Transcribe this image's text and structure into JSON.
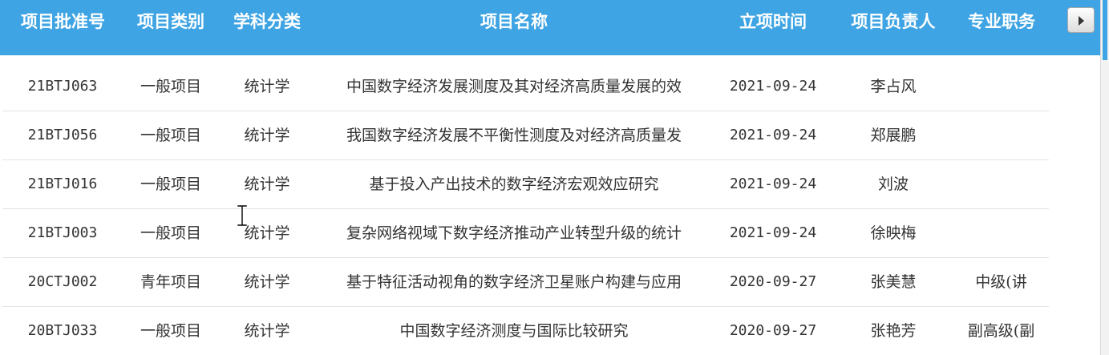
{
  "table": {
    "headers": [
      "项目批准号",
      "项目类别",
      "学科分类",
      "项目名称",
      "立项时间",
      "项目负责人",
      "专业职务"
    ],
    "rows": [
      [
        "21BTJ063",
        "一般项目",
        "统计学",
        "中国数字经济发展测度及其对经济高质量发展的效",
        "2021-09-24",
        "李占风",
        ""
      ],
      [
        "21BTJ056",
        "一般项目",
        "统计学",
        "我国数字经济发展不平衡性测度及对经济高质量发",
        "2021-09-24",
        "郑展鹏",
        ""
      ],
      [
        "21BTJ016",
        "一般项目",
        "统计学",
        "基于投入产出技术的数字经济宏观效应研究",
        "2021-09-24",
        "刘波",
        ""
      ],
      [
        "21BTJ003",
        "一般项目",
        "统计学",
        "复杂网络视域下数字经济推动产业转型升级的统计",
        "2021-09-24",
        "徐映梅",
        ""
      ],
      [
        "20CTJ002",
        "青年项目",
        "统计学",
        "基于特征活动视角的数字经济卫星账户构建与应用",
        "2020-09-27",
        "张美慧",
        "中级(讲"
      ],
      [
        "20BTJ033",
        "一般项目",
        "统计学",
        "中国数字经济测度与国际比较研究",
        "2020-09-27",
        "张艳芳",
        "副高级(副"
      ]
    ]
  },
  "icons": {
    "scroll_right": "chevron-right-icon",
    "cursor": "text-cursor-icon"
  },
  "colors": {
    "header_bg": "#3fa4e3",
    "header_text": "#ffffff",
    "cell_text": "#333333",
    "row_divider": "#e3e3e3"
  }
}
